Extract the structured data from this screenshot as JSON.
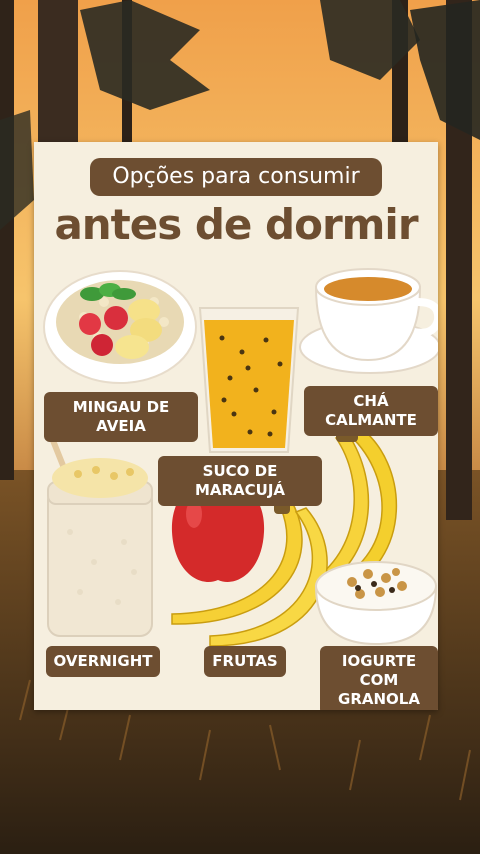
{
  "card": {
    "subtitle": "Opções para consumir",
    "title": "antes de dormir"
  },
  "labels": {
    "oatmeal": "MINGAU DE AVEIA",
    "tea": "CHÁ CALMANTE",
    "juice": "SUCO DE MARACUJÁ",
    "overnight": "OVERNIGHT",
    "fruits": "FRUTAS",
    "yogurt_line1": "IOGURTE COM",
    "yogurt_line2": "GRANOLA"
  },
  "colors": {
    "accent": "#6d4e31",
    "card_bg": "#f6efdf",
    "sky_top": "#f5a44a",
    "sky_bottom": "#f3c46d"
  }
}
